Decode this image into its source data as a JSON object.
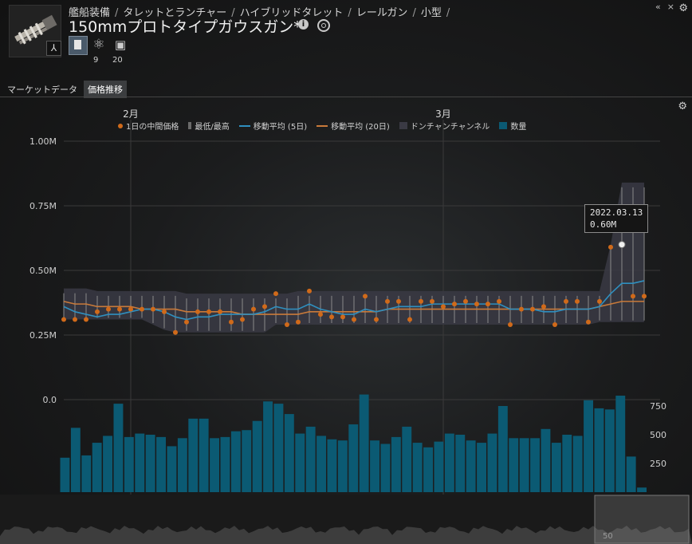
{
  "window": {
    "collapse_icon": "«",
    "close_icon": "×"
  },
  "header": {
    "breadcrumb": [
      "艦船装備",
      "タレットとランチャー",
      "ハイブリッドタレット",
      "レールガン",
      "小型"
    ],
    "title": "150mmプロトタイプガウスガン*",
    "counts": {
      "atom": "9",
      "chip": "20"
    }
  },
  "tabs": [
    {
      "label": "マーケットデータ",
      "active": false
    },
    {
      "label": "価格推移",
      "active": true
    }
  ],
  "legend": {
    "median": "1日の中間価格",
    "minmax": "最低/最高",
    "ma5": "移動平均 (5日)",
    "ma20": "移動平均 (20日)",
    "donchian": "ドンチャンチャンネル",
    "volume": "数量"
  },
  "colors": {
    "median": "#d06a1a",
    "ma5": "#2f8fbf",
    "ma20": "#c97a3a",
    "donchian": "#3a3a44",
    "volume": "#0b5a73",
    "minmax": "#8a8a8a"
  },
  "tooltip": {
    "date": "2022.03.13",
    "value": "0.60M"
  },
  "chart_data": {
    "type": "line",
    "months": [
      {
        "label": "2月",
        "day": 7
      },
      {
        "label": "3月",
        "day": 35
      }
    ],
    "price_axis": {
      "ticks": [
        {
          "v": 1.0,
          "label": "1.00M"
        },
        {
          "v": 0.75,
          "label": "0.75M"
        },
        {
          "v": 0.5,
          "label": "0.50M"
        },
        {
          "v": 0.25,
          "label": "0.25M"
        },
        {
          "v": 0.0,
          "label": "0.0"
        }
      ],
      "ylim": [
        0.0,
        1.0
      ]
    },
    "volume_axis": {
      "ticks": [
        {
          "v": 750,
          "label": "750"
        },
        {
          "v": 500,
          "label": "500"
        },
        {
          "v": 250,
          "label": "250"
        }
      ],
      "ylim": [
        0,
        1000
      ]
    },
    "minimap_label": "50",
    "median": [
      0.31,
      0.31,
      0.31,
      0.34,
      0.35,
      0.35,
      0.35,
      0.35,
      0.35,
      0.34,
      0.26,
      0.3,
      0.34,
      0.34,
      0.34,
      0.3,
      0.31,
      0.35,
      0.36,
      0.41,
      0.29,
      0.3,
      0.42,
      0.33,
      0.32,
      0.32,
      0.31,
      0.4,
      0.31,
      0.38,
      0.38,
      0.31,
      0.38,
      0.38,
      0.36,
      0.37,
      0.38,
      0.37,
      0.37,
      0.38,
      0.29,
      0.35,
      0.35,
      0.36,
      0.29,
      0.38,
      0.38,
      0.3,
      0.38,
      0.59,
      0.6,
      0.4,
      0.4
    ],
    "ma5": [
      0.36,
      0.34,
      0.33,
      0.32,
      0.33,
      0.33,
      0.34,
      0.35,
      0.35,
      0.34,
      0.32,
      0.31,
      0.32,
      0.32,
      0.33,
      0.33,
      0.33,
      0.33,
      0.34,
      0.36,
      0.35,
      0.35,
      0.37,
      0.35,
      0.34,
      0.33,
      0.33,
      0.35,
      0.34,
      0.35,
      0.36,
      0.36,
      0.36,
      0.37,
      0.37,
      0.37,
      0.37,
      0.37,
      0.37,
      0.37,
      0.35,
      0.35,
      0.35,
      0.34,
      0.34,
      0.35,
      0.35,
      0.35,
      0.36,
      0.41,
      0.45,
      0.45,
      0.46
    ],
    "ma20": [
      0.38,
      0.37,
      0.37,
      0.36,
      0.36,
      0.36,
      0.36,
      0.35,
      0.35,
      0.35,
      0.35,
      0.34,
      0.34,
      0.34,
      0.34,
      0.34,
      0.33,
      0.33,
      0.33,
      0.33,
      0.33,
      0.33,
      0.34,
      0.34,
      0.34,
      0.34,
      0.34,
      0.34,
      0.34,
      0.35,
      0.35,
      0.35,
      0.35,
      0.35,
      0.35,
      0.35,
      0.35,
      0.35,
      0.35,
      0.35,
      0.35,
      0.35,
      0.35,
      0.35,
      0.35,
      0.35,
      0.35,
      0.35,
      0.36,
      0.37,
      0.38,
      0.38,
      0.38
    ],
    "donchian_high": [
      0.43,
      0.43,
      0.43,
      0.42,
      0.42,
      0.42,
      0.42,
      0.42,
      0.42,
      0.42,
      0.42,
      0.41,
      0.41,
      0.41,
      0.41,
      0.41,
      0.41,
      0.41,
      0.41,
      0.41,
      0.41,
      0.42,
      0.42,
      0.42,
      0.42,
      0.42,
      0.42,
      0.42,
      0.42,
      0.42,
      0.42,
      0.42,
      0.42,
      0.42,
      0.42,
      0.42,
      0.42,
      0.42,
      0.42,
      0.42,
      0.42,
      0.42,
      0.42,
      0.42,
      0.42,
      0.42,
      0.42,
      0.42,
      0.42,
      0.6,
      0.84,
      0.84,
      0.84
    ],
    "donchian_low": [
      0.31,
      0.31,
      0.31,
      0.31,
      0.31,
      0.31,
      0.31,
      0.31,
      0.29,
      0.27,
      0.26,
      0.26,
      0.26,
      0.26,
      0.26,
      0.26,
      0.26,
      0.26,
      0.26,
      0.29,
      0.29,
      0.29,
      0.29,
      0.29,
      0.29,
      0.29,
      0.29,
      0.29,
      0.29,
      0.29,
      0.29,
      0.29,
      0.29,
      0.29,
      0.29,
      0.29,
      0.29,
      0.29,
      0.29,
      0.29,
      0.29,
      0.29,
      0.29,
      0.29,
      0.29,
      0.29,
      0.29,
      0.29,
      0.3,
      0.3,
      0.3,
      0.3,
      0.3
    ],
    "volume": [
      300,
      560,
      320,
      430,
      490,
      770,
      480,
      510,
      500,
      480,
      400,
      470,
      640,
      640,
      470,
      480,
      530,
      540,
      620,
      790,
      770,
      680,
      510,
      570,
      490,
      460,
      450,
      590,
      850,
      450,
      420,
      480,
      570,
      430,
      390,
      440,
      510,
      500,
      450,
      430,
      510,
      750,
      470,
      470,
      470,
      550,
      430,
      500,
      490,
      800,
      730,
      720,
      840,
      310,
      40
    ]
  }
}
